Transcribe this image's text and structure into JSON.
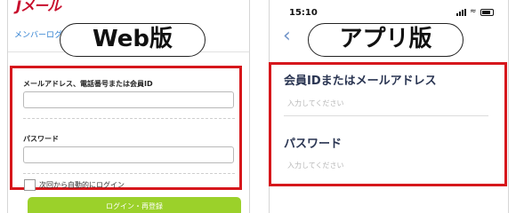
{
  "web": {
    "logo": "Jメール",
    "member_link": "メンバーログイン",
    "badge": "Web版",
    "email_label": "メールアドレス、電話番号または会員ID",
    "password_label": "パスワード",
    "auto_login_label": "次回から自動的にログイン",
    "login_button": "ログイン・再登録"
  },
  "app": {
    "status_time": "15:10",
    "badge": "アプリ版",
    "id_label": "会員IDまたはメールアドレス",
    "id_placeholder": "入力してください",
    "password_label": "パスワード",
    "password_placeholder": "入力してください"
  },
  "colors": {
    "highlight_border": "#d6171c",
    "login_button": "#9bd12a",
    "link": "#2f7fd0",
    "brand": "#c8102e"
  }
}
